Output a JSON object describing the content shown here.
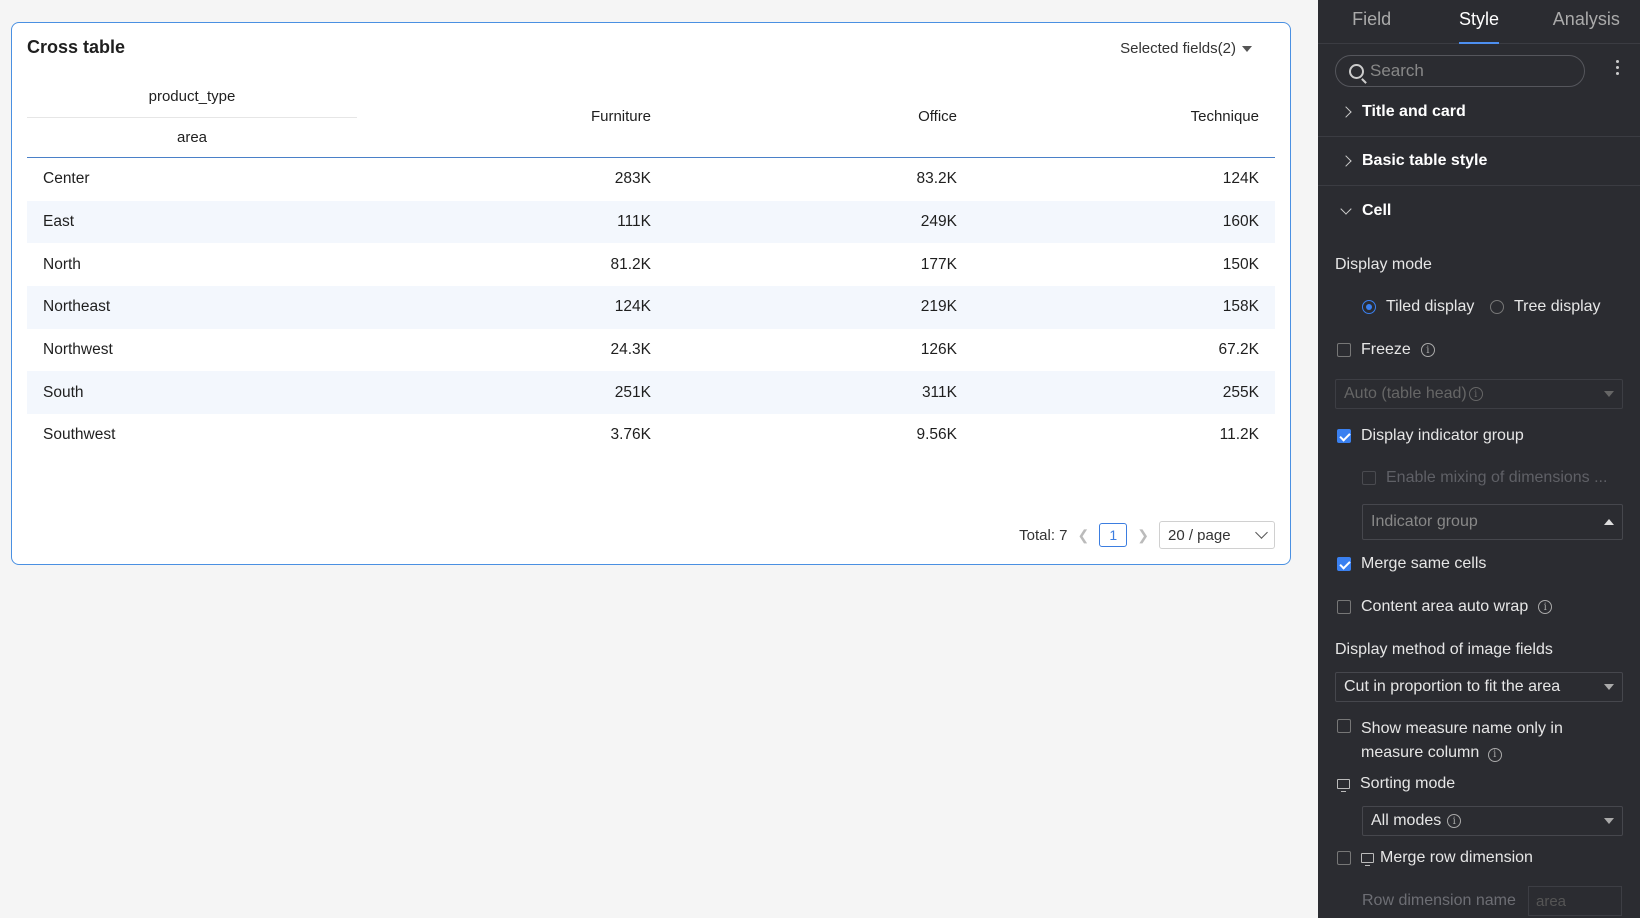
{
  "chart": {
    "title": "Cross table",
    "selected_fields": "Selected fields(2)",
    "header": {
      "col_dimension": "product_type",
      "row_dimension": "area",
      "columns": [
        "Furniture",
        "Office",
        "Technique"
      ]
    },
    "rows": [
      {
        "area": "Center",
        "values": [
          "283K",
          "83.2K",
          "124K"
        ]
      },
      {
        "area": "East",
        "values": [
          "111K",
          "249K",
          "160K"
        ]
      },
      {
        "area": "North",
        "values": [
          "81.2K",
          "177K",
          "150K"
        ]
      },
      {
        "area": "Northeast",
        "values": [
          "124K",
          "219K",
          "158K"
        ]
      },
      {
        "area": "Northwest",
        "values": [
          "24.3K",
          "126K",
          "67.2K"
        ]
      },
      {
        "area": "South",
        "values": [
          "251K",
          "311K",
          "255K"
        ]
      },
      {
        "area": "Southwest",
        "values": [
          "3.76K",
          "9.56K",
          "11.2K"
        ]
      }
    ],
    "pagination": {
      "total": "Total: 7",
      "current_page": "1",
      "page_size": "20 / page"
    }
  },
  "panel": {
    "tabs": [
      "Field",
      "Style",
      "Analysis"
    ],
    "active_tab": "Style",
    "search_placeholder": "Search",
    "sections": {
      "title_and_card": "Title and card",
      "basic_table_style": "Basic table style",
      "cell": "Cell"
    },
    "cell": {
      "display_mode_label": "Display mode",
      "tiled_display": "Tiled display",
      "tree_display": "Tree display",
      "freeze": "Freeze",
      "freeze_select": "Auto (table head)",
      "display_indicator_group": "Display indicator group",
      "enable_mixing": "Enable mixing of dimensions ...",
      "indicator_group": "Indicator group",
      "merge_same_cells": "Merge same cells",
      "content_auto_wrap": "Content area auto wrap",
      "image_display_label": "Display method of image fields",
      "image_display_value": "Cut in proportion to fit the area",
      "show_measure_name_1": "Show measure name only in",
      "show_measure_name_2": "measure column",
      "sorting_mode": "Sorting mode",
      "sorting_value": "All modes",
      "merge_row_dimension": "Merge row dimension",
      "row_dimension_name": "Row dimension name",
      "row_dimension_placeholder": "area"
    }
  },
  "colors": {
    "accent": "#3a80f0",
    "panel_bg": "#2b2c31",
    "row_alt": "#f3f7fd"
  }
}
